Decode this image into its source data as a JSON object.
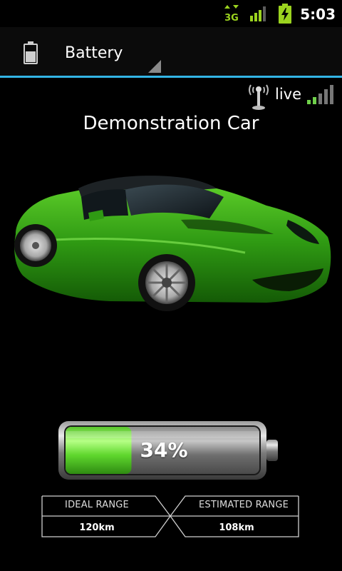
{
  "status_bar": {
    "time": "5:03",
    "network": "3G",
    "icons": [
      "3g-data-icon",
      "signal-strength-icon",
      "charging-battery-icon"
    ]
  },
  "action_bar": {
    "title": "Battery",
    "icon": "battery-icon"
  },
  "connection": {
    "label": "live",
    "icons": [
      "antenna-icon",
      "signal-bars-icon"
    ]
  },
  "car": {
    "name": "Demonstration Car",
    "image": "green-roadster-image"
  },
  "battery": {
    "level": 0.34,
    "percent_label": "34%",
    "fill_color": "#7be84a"
  },
  "range": {
    "ideal_label": "IDEAL RANGE",
    "ideal_value": "120km",
    "estimated_label": "ESTIMATED RANGE",
    "estimated_value": "108km"
  },
  "colors": {
    "accent": "#33b5e5",
    "status_green": "#9bd31f"
  }
}
